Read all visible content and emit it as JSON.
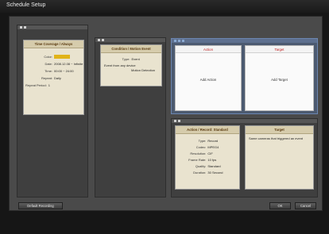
{
  "window": {
    "title": "Schedule Setup"
  },
  "time_coverage": {
    "header": "Time Coverage / Always",
    "rows": [
      {
        "label": "Color:",
        "value": ""
      },
      {
        "label": "Date:",
        "value": "2008.12.08 ~ Infinite"
      },
      {
        "label": "Time:",
        "value": "00:00 ~ 24:00"
      },
      {
        "label": "Repeat:",
        "value": "Daily"
      },
      {
        "label": "Repeat Period:",
        "value": "1"
      }
    ],
    "color": "#e1b318"
  },
  "condition": {
    "header": "Condition / Motion Event",
    "type_label": "Type:",
    "type_value": "Event",
    "desc_line1": "Event from any device",
    "desc_line2": "Motion Detection"
  },
  "action_box": {
    "header": "Action",
    "placeholder": "Add Action"
  },
  "target_box": {
    "header": "Target",
    "placeholder": "Add Target"
  },
  "action_record": {
    "header": "Action / Record: Standard",
    "rows": [
      {
        "label": "Type:",
        "value": "Record"
      },
      {
        "label": "Codec:",
        "value": "MPEG4"
      },
      {
        "label": "Resolution:",
        "value": "CIF"
      },
      {
        "label": "Frame Rate:",
        "value": "10 fps"
      },
      {
        "label": "Quality:",
        "value": "Standard"
      },
      {
        "label": "Duration:",
        "value": "30 Second"
      }
    ]
  },
  "target_record": {
    "header": "Target",
    "text": "Same cameras that triggered an event"
  },
  "buttons": {
    "default_recording": "Default Recording",
    "ok": "OK",
    "cancel": "Cancel"
  }
}
